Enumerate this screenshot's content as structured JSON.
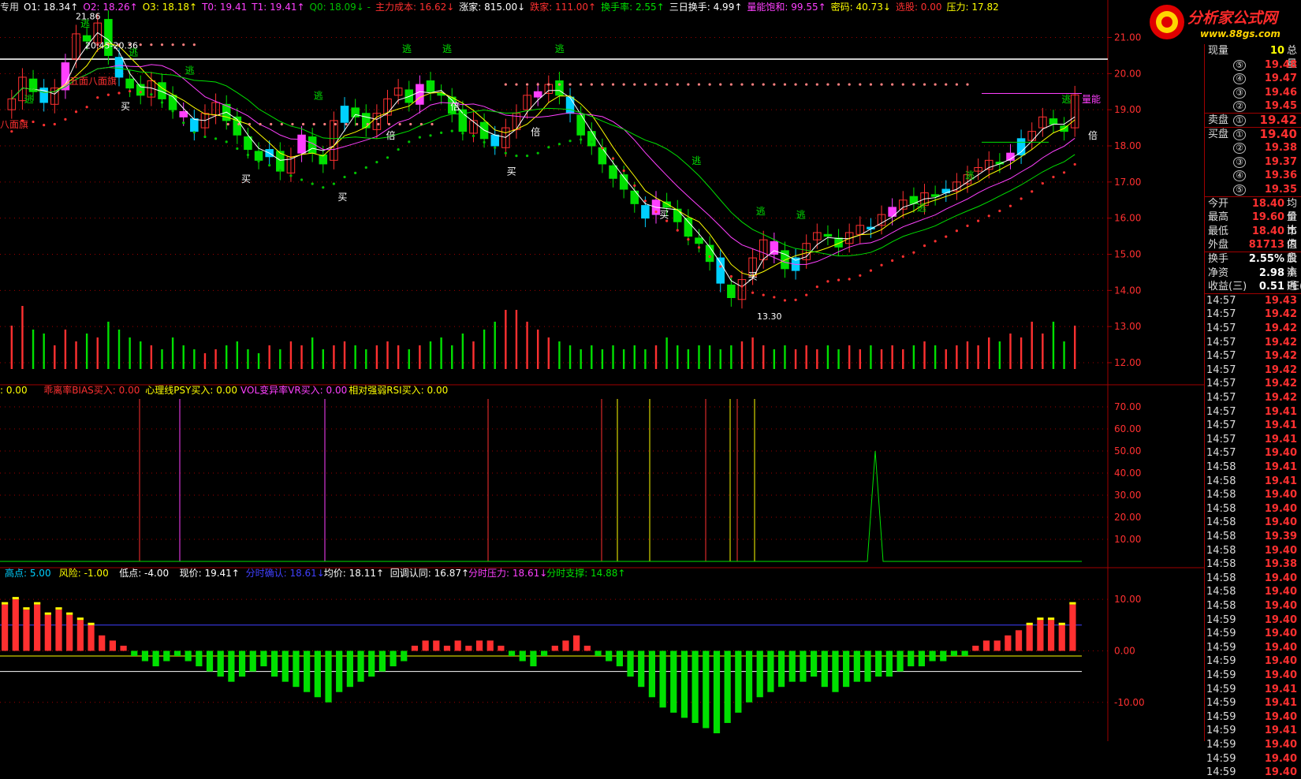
{
  "colors": {
    "up": "#ff3030",
    "down": "#00e000",
    "flat": "#ffffff",
    "cyan": "#00d0ff",
    "yellow": "#ffff00",
    "magenta": "#ff40ff",
    "grid": "#a00000"
  },
  "header": [
    {
      "text": "专用",
      "color": "#ddd"
    },
    {
      "text": "O1: 18.34↑",
      "color": "#ffffff"
    },
    {
      "text": "O2: 18.26↑",
      "color": "#ff40ff"
    },
    {
      "text": "O3: 18.18↑",
      "color": "#ffff00"
    },
    {
      "text": "T0: 19.41",
      "color": "#ff40ff"
    },
    {
      "text": "T1: 19.41↑",
      "color": "#ff40ff"
    },
    {
      "text": "Q0: 18.09↓ -",
      "color": "#00c000"
    },
    {
      "text": "主力成本: 16.62↓",
      "color": "#ff3030"
    },
    {
      "text": "涨家: 815.00↓",
      "color": "#ffffff"
    },
    {
      "text": "跌家: 111.00↑",
      "color": "#ff3030"
    },
    {
      "text": "换手率: 2.55↑",
      "color": "#00e000"
    },
    {
      "text": "三日换手: 4.99↑",
      "color": "#ffffff"
    },
    {
      "text": "量能饱和: 99.55↑",
      "color": "#ff40ff"
    },
    {
      "text": "密码: 40.73↓",
      "color": "#ffff00"
    },
    {
      "text": "选股: 0.00",
      "color": "#ff3030"
    },
    {
      "text": "压力: 17.82",
      "color": "#ffff00"
    }
  ],
  "logo": {
    "name": "分析家公式网",
    "url": "www.88gs.com"
  },
  "sub_header": [
    {
      "text": ": 0.00",
      "color": "#ffff00"
    },
    {
      "text": "乖离率BIAS买入: 0.00",
      "color": "#ff3030"
    },
    {
      "text": "心理线PSY买入: 0.00",
      "color": "#ffff00"
    },
    {
      "text": "VOL变异率VR买入: 0.00",
      "color": "#ff40ff"
    },
    {
      "text": "相对强弱RSI买入: 0.00",
      "color": "#ffff00"
    }
  ],
  "low_header": [
    {
      "text": "高点: 5.00",
      "color": "#00d0ff"
    },
    {
      "text": "风险: -1.00",
      "color": "#ffff00"
    },
    {
      "text": "低点: -4.00",
      "color": "#ffffff"
    },
    {
      "text": "现价: 19.41↑",
      "color": "#ffffff"
    },
    {
      "text": "分时确认: 18.61↓",
      "color": "#4040ff"
    },
    {
      "text": "均价: 18.11↑",
      "color": "#ffffff"
    },
    {
      "text": "回调认同: 16.87↑",
      "color": "#ffffff"
    },
    {
      "text": "分时压力: 18.61↓",
      "color": "#ff40ff"
    },
    {
      "text": "分时支撑: 14.88↑",
      "color": "#00e000"
    }
  ],
  "chart_labels": {
    "high_mark": "21.86",
    "range_mark": "20.45-20.36",
    "low_mark": "13.30",
    "flag1": "五面八面旗",
    "flag2": "八面旗",
    "buy": "买",
    "escape": "逃",
    "double": "倍",
    "volume": "量能"
  },
  "chart_data": [
    {
      "type": "candlestick",
      "name": "price",
      "ylim": [
        12.0,
        21.6
      ],
      "yticks": [
        "21.00",
        "20.00",
        "19.00",
        "18.00",
        "17.00",
        "16.00",
        "15.00",
        "14.00",
        "13.00",
        "12.00"
      ],
      "ytick_values": [
        21,
        20,
        19,
        18,
        17,
        16,
        15,
        14,
        13,
        12
      ],
      "close": [
        19.3,
        19.9,
        19.5,
        19.2,
        19.6,
        20.3,
        21.1,
        20.9,
        21.4,
        20.5,
        19.9,
        19.6,
        19.4,
        19.8,
        19.3,
        19.0,
        18.8,
        18.4,
        18.9,
        19.2,
        18.7,
        18.3,
        17.9,
        17.6,
        17.9,
        17.3,
        17.7,
        18.3,
        17.8,
        17.5,
        18.7,
        19.1,
        18.8,
        18.5,
        18.9,
        19.3,
        19.6,
        19.2,
        19.7,
        19.5,
        19.4,
        18.9,
        18.4,
        18.7,
        18.2,
        18.0,
        18.5,
        18.9,
        19.4,
        19.5,
        19.7,
        19.4,
        18.9,
        18.3,
        18.0,
        17.5,
        17.1,
        16.8,
        16.4,
        16.0,
        16.5,
        16.3,
        15.9,
        15.5,
        15.3,
        14.8,
        14.2,
        13.8,
        14.3,
        14.9,
        15.4,
        15.0,
        14.6,
        14.9,
        15.3,
        15.6,
        15.5,
        15.2,
        15.6,
        15.8,
        15.7,
        16.1,
        16.3,
        16.5,
        16.4,
        16.7,
        16.6,
        16.8,
        17.0,
        17.2,
        17.4,
        17.6,
        17.5,
        17.8,
        18.2,
        18.4,
        18.8,
        18.6,
        18.4,
        19.41
      ],
      "volume": [
        0.55,
        0.8,
        0.5,
        0.45,
        0.3,
        0.5,
        0.35,
        0.45,
        0.4,
        0.6,
        0.5,
        0.4,
        0.35,
        0.3,
        0.25,
        0.4,
        0.3,
        0.25,
        0.2,
        0.25,
        0.3,
        0.35,
        0.25,
        0.2,
        0.3,
        0.25,
        0.35,
        0.3,
        0.4,
        0.25,
        0.3,
        0.35,
        0.3,
        0.25,
        0.3,
        0.35,
        0.3,
        0.25,
        0.3,
        0.35,
        0.4,
        0.3,
        0.45,
        0.35,
        0.5,
        0.6,
        0.75,
        0.75,
        0.6,
        0.5,
        0.4,
        0.35,
        0.3,
        0.25,
        0.3,
        0.25,
        0.3,
        0.25,
        0.3,
        0.25,
        0.3,
        0.4,
        0.3,
        0.25,
        0.3,
        0.3,
        0.25,
        0.3,
        0.35,
        0.4,
        0.3,
        0.25,
        0.3,
        0.25,
        0.3,
        0.25,
        0.3,
        0.25,
        0.3,
        0.25,
        0.3,
        0.25,
        0.3,
        0.25,
        0.3,
        0.35,
        0.3,
        0.25,
        0.3,
        0.35,
        0.3,
        0.4,
        0.35,
        0.45,
        0.4,
        0.6,
        0.45,
        0.6,
        0.35,
        0.55
      ]
    },
    {
      "type": "line",
      "name": "indicator",
      "ylim": [
        0,
        75
      ],
      "yticks": [
        "70.00",
        "60.00",
        "50.00",
        "40.00",
        "30.00",
        "20.00",
        "10.00"
      ],
      "ytick_values": [
        70,
        60,
        50,
        40,
        30,
        20,
        10
      ],
      "spike_index": 82,
      "spike_value": 50
    },
    {
      "type": "bar",
      "name": "oscillator",
      "ylim": [
        -16,
        14
      ],
      "yticks": [
        "10.00",
        "0.00",
        "-10.00"
      ],
      "ytick_values": [
        10,
        0,
        -10
      ],
      "reference_lines": [
        5,
        -1,
        -4
      ],
      "values": [
        9,
        10,
        8,
        9,
        7,
        8,
        7,
        6,
        5,
        3,
        2,
        1,
        -1,
        -2,
        -3,
        -2,
        -1,
        -2,
        -3,
        -4,
        -5,
        -6,
        -5,
        -4,
        -3,
        -5,
        -6,
        -7,
        -8,
        -9,
        -10,
        -8,
        -7,
        -6,
        -5,
        -4,
        -3,
        -2,
        1,
        2,
        2,
        1,
        2,
        1,
        2,
        2,
        1,
        -1,
        -2,
        -3,
        -1,
        1,
        2,
        3,
        1,
        -1,
        -2,
        -3,
        -5,
        -7,
        -9,
        -11,
        -12,
        -13,
        -14,
        -15,
        -16,
        -14,
        -12,
        -10,
        -9,
        -8,
        -7,
        -6,
        -6,
        -5,
        -7,
        -8,
        -7,
        -6,
        -6,
        -5,
        -5,
        -4,
        -3,
        -3,
        -2,
        -2,
        -1,
        -1,
        1,
        2,
        2,
        3,
        4,
        5,
        6,
        6,
        5,
        9
      ]
    }
  ],
  "quote_panel": {
    "top": [
      {
        "label": "现量",
        "value": "10",
        "extra": "总量"
      }
    ],
    "asks": [
      {
        "n": "⑤",
        "v": "19.48"
      },
      {
        "n": "④",
        "v": "19.47"
      },
      {
        "n": "③",
        "v": "19.46"
      },
      {
        "n": "②",
        "v": "19.45"
      }
    ],
    "ask1": {
      "label": "卖盘",
      "n": "①",
      "v": "19.42"
    },
    "bid1": {
      "label": "买盘",
      "n": "①",
      "v": "19.40"
    },
    "bids": [
      {
        "n": "②",
        "v": "19.38"
      },
      {
        "n": "③",
        "v": "19.37"
      },
      {
        "n": "④",
        "v": "19.36"
      },
      {
        "n": "⑤",
        "v": "19.35"
      }
    ],
    "stats": [
      {
        "label": "今开",
        "v": "18.40",
        "extra": "均价",
        "color": "#ff3030"
      },
      {
        "label": "最高",
        "v": "19.60",
        "extra": "量比",
        "color": "#ff3030"
      },
      {
        "label": "最低",
        "v": "18.40",
        "extra": "市值",
        "color": "#ff3030"
      },
      {
        "label": "外盘",
        "v": "81713",
        "extra": "内盘",
        "color": "#ff3030"
      }
    ],
    "stats2": [
      {
        "label": "换手",
        "v": "2.55%",
        "extra": "股本",
        "color": "#ffffff"
      },
      {
        "label": "净资",
        "v": "2.98",
        "extra": "流通",
        "color": "#ffffff"
      },
      {
        "label": "收益(三)",
        "v": "0.51",
        "extra": "PE(",
        "color": "#ffffff"
      }
    ],
    "ticks": [
      {
        "t": "14:57",
        "p": "19.43"
      },
      {
        "t": "14:57",
        "p": "19.42"
      },
      {
        "t": "14:57",
        "p": "19.42"
      },
      {
        "t": "14:57",
        "p": "19.42"
      },
      {
        "t": "14:57",
        "p": "19.42"
      },
      {
        "t": "14:57",
        "p": "19.42"
      },
      {
        "t": "14:57",
        "p": "19.42"
      },
      {
        "t": "14:57",
        "p": "19.42"
      },
      {
        "t": "14:57",
        "p": "19.41"
      },
      {
        "t": "14:57",
        "p": "19.41"
      },
      {
        "t": "14:57",
        "p": "19.41"
      },
      {
        "t": "14:57",
        "p": "19.40"
      },
      {
        "t": "14:58",
        "p": "19.41"
      },
      {
        "t": "14:58",
        "p": "19.41"
      },
      {
        "t": "14:58",
        "p": "19.40"
      },
      {
        "t": "14:58",
        "p": "19.40"
      },
      {
        "t": "14:58",
        "p": "19.40"
      },
      {
        "t": "14:58",
        "p": "19.39"
      },
      {
        "t": "14:58",
        "p": "19.40"
      },
      {
        "t": "14:58",
        "p": "19.38"
      },
      {
        "t": "14:58",
        "p": "19.40"
      },
      {
        "t": "14:58",
        "p": "19.40"
      },
      {
        "t": "14:58",
        "p": "19.40"
      },
      {
        "t": "14:59",
        "p": "19.40"
      },
      {
        "t": "14:59",
        "p": "19.40"
      },
      {
        "t": "14:59",
        "p": "19.40"
      },
      {
        "t": "14:59",
        "p": "19.40"
      },
      {
        "t": "14:59",
        "p": "19.40"
      },
      {
        "t": "14:59",
        "p": "19.41"
      },
      {
        "t": "14:59",
        "p": "19.41"
      },
      {
        "t": "14:59",
        "p": "19.40"
      },
      {
        "t": "14:59",
        "p": "19.41"
      },
      {
        "t": "14:59",
        "p": "19.40"
      },
      {
        "t": "14:59",
        "p": "19.40"
      },
      {
        "t": "14:59",
        "p": "19.40"
      }
    ]
  }
}
